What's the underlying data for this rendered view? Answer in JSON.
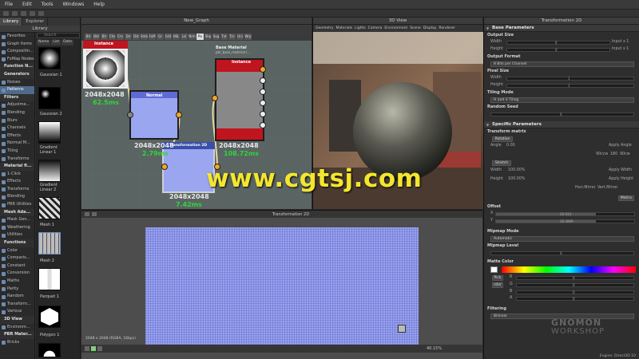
{
  "menu": [
    "File",
    "Edit",
    "Tools",
    "Windows",
    "Help"
  ],
  "library": {
    "tabs": [
      "Library",
      "Explorer"
    ],
    "title": "Library",
    "search_placeholder": "Search",
    "sort_labels": [
      "Name",
      "List",
      "Date"
    ],
    "categories": [
      {
        "label": "Favorites",
        "type": "item"
      },
      {
        "label": "Graph Items",
        "type": "item"
      },
      {
        "label": "Compositin...",
        "type": "item"
      },
      {
        "label": "FxMap Nodes",
        "type": "item"
      },
      {
        "label": "Function N...",
        "type": "section"
      },
      {
        "label": "Generators",
        "type": "section"
      },
      {
        "label": "Noises",
        "type": "item"
      },
      {
        "label": "Patterns",
        "type": "item",
        "selected": true
      },
      {
        "label": "Filters",
        "type": "section"
      },
      {
        "label": "Adjustme...",
        "type": "item"
      },
      {
        "label": "Blending",
        "type": "item"
      },
      {
        "label": "Blurs",
        "type": "item"
      },
      {
        "label": "Channels",
        "type": "item"
      },
      {
        "label": "Effects",
        "type": "item"
      },
      {
        "label": "Normal M...",
        "type": "item"
      },
      {
        "label": "Tiling",
        "type": "item"
      },
      {
        "label": "Transforms",
        "type": "item"
      },
      {
        "label": "Material fi...",
        "type": "section"
      },
      {
        "label": "1-Click",
        "type": "item"
      },
      {
        "label": "Effects",
        "type": "item"
      },
      {
        "label": "Transforms",
        "type": "item"
      },
      {
        "label": "Blending",
        "type": "item"
      },
      {
        "label": "PBR Utilities",
        "type": "item"
      },
      {
        "label": "Mesh Ada...",
        "type": "section"
      },
      {
        "label": "Mask Gen...",
        "type": "item"
      },
      {
        "label": "Weathering",
        "type": "item"
      },
      {
        "label": "Utilities",
        "type": "item"
      },
      {
        "label": "Functions",
        "type": "section"
      },
      {
        "label": "Color",
        "type": "item"
      },
      {
        "label": "Comparis...",
        "type": "item"
      },
      {
        "label": "Constant",
        "type": "item"
      },
      {
        "label": "Conversion",
        "type": "item"
      },
      {
        "label": "Maths",
        "type": "item"
      },
      {
        "label": "Parity",
        "type": "item"
      },
      {
        "label": "Random",
        "type": "item"
      },
      {
        "label": "Transform...",
        "type": "item"
      },
      {
        "label": "Various",
        "type": "item"
      },
      {
        "label": "3D View",
        "type": "section"
      },
      {
        "label": "Environm...",
        "type": "item"
      },
      {
        "label": "PBR Mater...",
        "type": "section"
      },
      {
        "label": "Bricks",
        "type": "item"
      }
    ],
    "thumbnails": [
      "Gaussian 1",
      "Gaussian 2",
      "Gradient Linear 1",
      "Gradient Linear 2",
      "Mesh 1",
      "Mesh 2",
      "Parquet 1",
      "Polygon 1"
    ]
  },
  "graph": {
    "title": "New_Graph",
    "nodes": {
      "instance_top": {
        "title": "Instance",
        "size": "2048x2048",
        "time": "62.5ms"
      },
      "normal": {
        "title": "Normal",
        "size": "2048x2048",
        "time": "2.79ms"
      },
      "transformation": {
        "title": "Transformation 2D",
        "size": "2048x2048",
        "time": "7.42ms"
      },
      "base_material": {
        "title": "Base Material",
        "subtitle": "pbr_base_material (...",
        "header": "Instance",
        "size": "2048x2048",
        "time": "108.72ms"
      }
    }
  },
  "view3d": {
    "title": "3D View",
    "menu": [
      "Geometry",
      "Materials",
      "Lights",
      "Camera",
      "Environment",
      "Scene",
      "Display",
      "Renderer"
    ]
  },
  "view2d": {
    "title": "Transformation 2D",
    "status": "2048 x 2048 (RGBA, 16bpc)",
    "zoom": "40.15%"
  },
  "params": {
    "title": "Transformation 2D",
    "base_section": "Base Parameters",
    "output_size": {
      "label": "Output Size",
      "width_label": "Width",
      "height_label": "Height",
      "width_value": "0",
      "height_value": "0",
      "width_inherit": "Input x 1",
      "height_inherit": "Input x 1"
    },
    "output_format": {
      "label": "Output Format",
      "value": "8 Bits per Channel"
    },
    "pixel_size": {
      "label": "Pixel Size",
      "width_label": "Width",
      "height_label": "Height",
      "width_value": "1",
      "height_value": "1"
    },
    "tiling_mode": {
      "label": "Tiling Mode",
      "value": "H and V Tiling"
    },
    "random_seed": {
      "label": "Random Seed",
      "value": "0"
    },
    "specific_section": "Specific Parameters",
    "transform_matrix": {
      "label": "Transform matrix",
      "rotation_btn": "Rotation",
      "angle_label": "Angle",
      "angle_value": "0.00",
      "apply_angle": "Apply Angle",
      "angle_presets": [
        "90ccw",
        "180",
        "90cw"
      ],
      "stretch_btn": "Stretch",
      "width_label": "Width",
      "width_value": "100.00%",
      "height_label": "Height",
      "height_value": "100.00%",
      "apply_width": "Apply Width",
      "apply_height": "Apply Height",
      "hor_mirror": "Hori.Mirror",
      "vert_mirror": "Vert.Mirror",
      "matrix_btn": "Matrix"
    },
    "offset": {
      "label": "Offset",
      "x_label": "X",
      "y_label": "Y",
      "x_value": "20.933",
      "y_value": "19.3969"
    },
    "mipmap_mode": {
      "label": "Mipmap Mode",
      "value": "Automatic"
    },
    "mipmap_level": {
      "label": "Mipmap Level",
      "value": "0"
    },
    "matte_color": {
      "label": "Matte Color",
      "pick": "Pick",
      "hsv": "HSV",
      "channels": [
        "R",
        "G",
        "B",
        "A"
      ],
      "values": [
        "0",
        "0",
        "0",
        "0"
      ]
    },
    "filtering": {
      "label": "Filtering",
      "value": "Bilinear"
    },
    "engine": "Engine: Direct3D 10"
  },
  "watermark": "www.cgtsj.com",
  "brand_watermark": {
    "top": "GNOMON",
    "bottom": "WORKSHOP"
  },
  "colors": {
    "accent": "#4f6a8a",
    "node_time": "#2fd53a",
    "node_red": "#c0141f",
    "watermark": "#f3e62e"
  }
}
